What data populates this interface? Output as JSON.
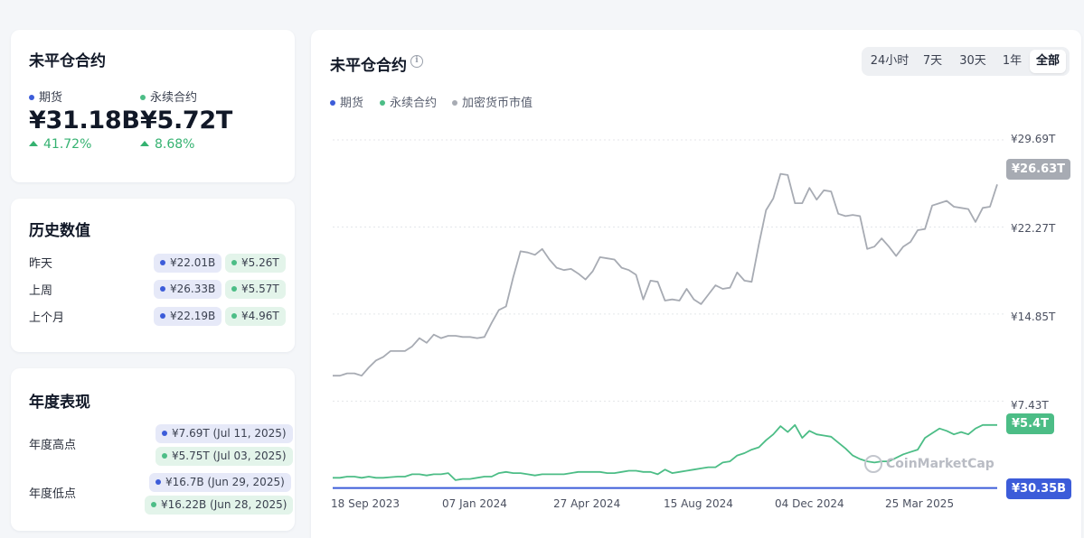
{
  "summary": {
    "title": "未平仓合约",
    "futures_label": "期货",
    "futures_value": "¥31.18B",
    "futures_change": "41.72%",
    "perp_label": "永续合约",
    "perp_value": "¥5.72T",
    "perp_change": "8.68%"
  },
  "history": {
    "title": "历史数值",
    "rows": [
      {
        "label": "昨天",
        "futures": "¥22.01B",
        "perp": "¥5.26T"
      },
      {
        "label": "上周",
        "futures": "¥26.33B",
        "perp": "¥5.57T"
      },
      {
        "label": "上个月",
        "futures": "¥22.19B",
        "perp": "¥4.96T"
      }
    ]
  },
  "yearly": {
    "title": "年度表现",
    "high_label": "年度高点",
    "high_futures": "¥7.69T (Jul 11, 2025)",
    "high_perp": "¥5.75T (Jul 03, 2025)",
    "low_label": "年度低点",
    "low_futures": "¥16.7B (Jun 29, 2025)",
    "low_perp": "¥16.22B (Jun 28, 2025)"
  },
  "chart_panel": {
    "title": "未平仓合约",
    "info_icon": "info-icon",
    "tabs": [
      "24小时",
      "7天",
      "30天",
      "1年",
      "全部"
    ],
    "active_tab": "全部",
    "watermark": "CoinMarketCap"
  },
  "colors": {
    "futures": "#3c5cd9",
    "perp": "#4cbd86",
    "market_cap": "#a7abb3"
  },
  "chart_data": {
    "type": "line",
    "legend_placement": "top-left",
    "grid": true,
    "x_ticks": [
      "18 Sep 2023",
      "07 Jan 2024",
      "27 Apr 2024",
      "15 Aug 2024",
      "04 Dec 2024",
      "25 Mar 2025"
    ],
    "y_ticks": [
      "¥29.69T",
      "¥22.27T",
      "¥14.85T",
      "¥7.43T"
    ],
    "ylim": [
      0,
      29.69
    ],
    "series": [
      {
        "name": "加密货币市值",
        "current_label": "¥26.63T",
        "values": [
          9.6,
          9.6,
          9.8,
          9.8,
          9.6,
          10.3,
          10.9,
          11.2,
          11.7,
          11.7,
          11.7,
          12.1,
          12.8,
          12.4,
          13.1,
          12.8,
          13.0,
          13.0,
          12.9,
          12.9,
          12.8,
          12.9,
          14.1,
          15.2,
          15.5,
          18.0,
          20.2,
          20.1,
          19.9,
          20.4,
          19.5,
          18.8,
          18.6,
          18.7,
          18.3,
          17.8,
          18.5,
          19.7,
          19.6,
          19.5,
          18.8,
          18.6,
          18.2,
          16.1,
          17.7,
          17.6,
          16.0,
          16.1,
          16.0,
          17.0,
          16.1,
          15.7,
          16.5,
          17.3,
          17.0,
          17.1,
          18.4,
          17.7,
          17.6,
          20.8,
          23.7,
          24.7,
          26.8,
          26.7,
          24.3,
          24.3,
          25.6,
          24.6,
          25.4,
          25.3,
          23.4,
          23.2,
          23.3,
          23.2,
          20.4,
          20.6,
          21.3,
          20.6,
          19.8,
          20.6,
          21.0,
          22.0,
          22.1,
          24.1,
          24.3,
          24.5,
          24.0,
          23.9,
          23.8,
          22.7,
          23.9,
          24.0,
          25.9
        ]
      },
      {
        "name": "永续合约",
        "current_label": "¥5.4T",
        "values": [
          0.9,
          0.9,
          1.0,
          1.0,
          0.9,
          1.0,
          0.9,
          0.9,
          0.95,
          1.0,
          1.0,
          1.2,
          1.2,
          1.1,
          1.2,
          1.2,
          1.3,
          0.7,
          0.8,
          0.8,
          0.9,
          1.0,
          1.0,
          1.3,
          1.4,
          1.3,
          1.3,
          1.2,
          1.1,
          1.2,
          1.2,
          1.2,
          1.2,
          1.3,
          1.4,
          1.4,
          1.4,
          1.4,
          1.3,
          1.3,
          1.4,
          1.5,
          1.5,
          1.4,
          1.4,
          1.2,
          1.6,
          1.3,
          1.4,
          1.5,
          1.6,
          1.7,
          1.8,
          1.8,
          2.2,
          2.3,
          2.8,
          3.0,
          3.3,
          3.5,
          4.1,
          4.6,
          5.3,
          4.8,
          5.4,
          4.3,
          4.9,
          4.6,
          4.5,
          4.4,
          3.9,
          3.4,
          2.8,
          2.5,
          2.3,
          2.2,
          2.3,
          2.3,
          2.6,
          2.9,
          3.1,
          3.3,
          4.3,
          4.7,
          5.1,
          4.9,
          4.6,
          4.8,
          4.6,
          5.1,
          5.4,
          5.4,
          5.4
        ]
      },
      {
        "name": "期货",
        "current_label": "¥30.35B",
        "values": [
          0.03,
          0.03,
          0.03,
          0.03,
          0.03,
          0.03,
          0.03,
          0.03,
          0.03,
          0.03,
          0.03,
          0.03,
          0.03,
          0.03,
          0.03,
          0.03,
          0.03,
          0.03,
          0.03,
          0.03,
          0.03,
          0.03,
          0.03,
          0.03,
          0.03,
          0.03,
          0.03,
          0.03,
          0.03,
          0.03,
          0.03,
          0.03,
          0.03,
          0.03,
          0.03,
          0.03,
          0.03,
          0.03,
          0.03,
          0.03,
          0.03,
          0.03,
          0.03,
          0.03,
          0.03,
          0.03,
          0.03,
          0.03,
          0.03,
          0.03,
          0.03,
          0.03,
          0.03,
          0.03,
          0.03,
          0.03,
          0.03,
          0.03,
          0.03,
          0.03,
          0.03,
          0.03,
          0.03,
          0.03,
          0.03,
          0.03,
          0.03,
          0.03,
          0.03,
          0.03,
          0.03,
          0.03,
          0.03,
          0.03,
          0.03,
          0.03,
          0.03,
          0.03,
          0.03,
          0.03,
          0.03,
          0.03,
          0.03,
          0.03,
          0.03,
          0.03,
          0.03,
          0.03,
          0.03,
          0.03,
          0.03,
          0.03,
          0.03
        ]
      }
    ]
  }
}
